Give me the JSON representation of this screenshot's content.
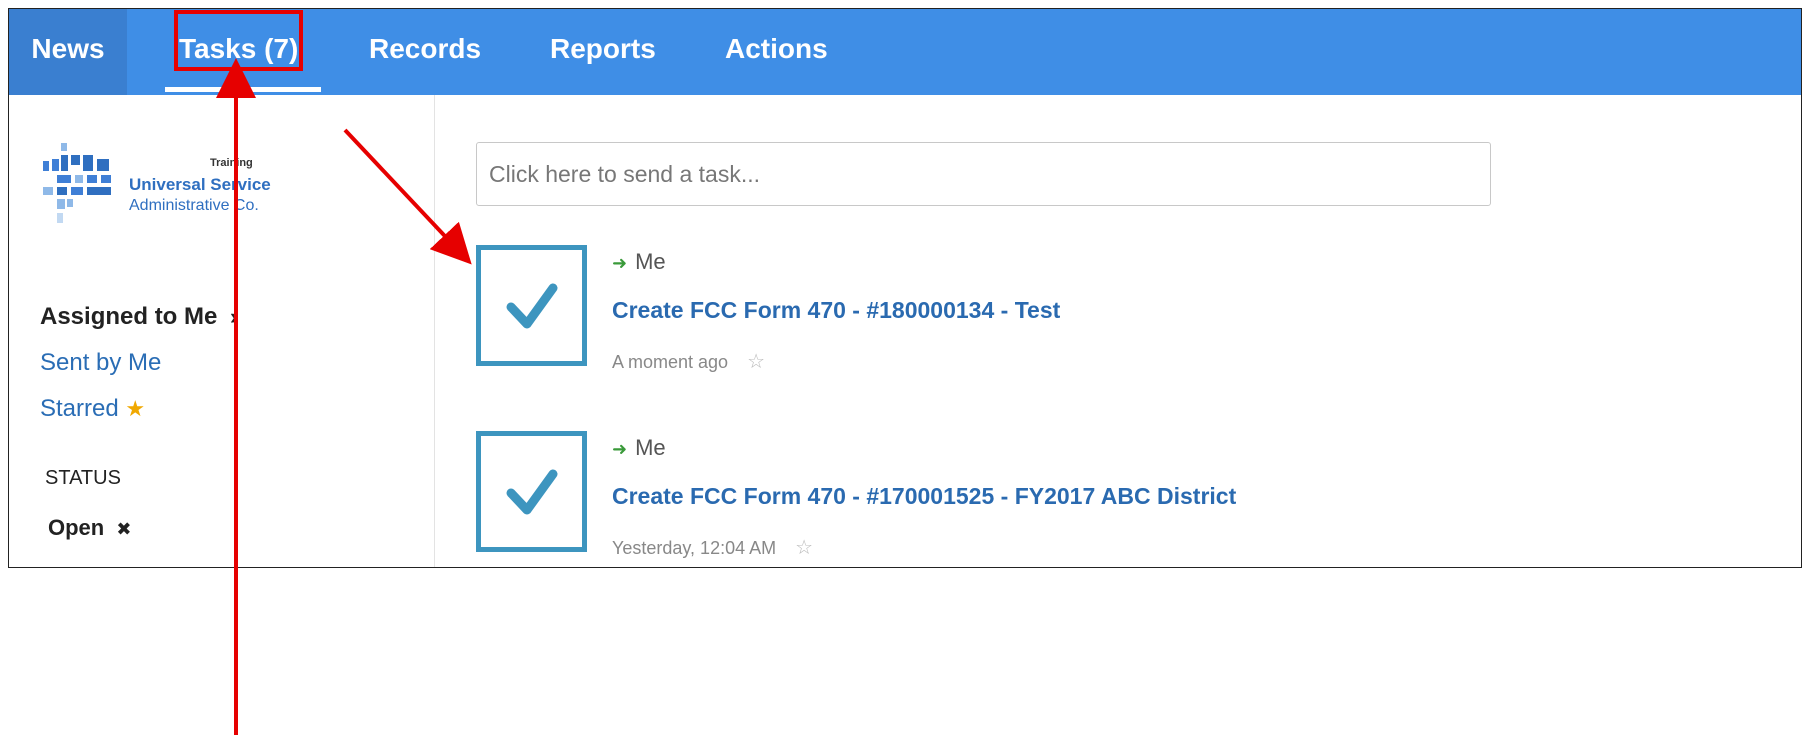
{
  "nav": {
    "news": "News",
    "tasks": "Tasks (7)",
    "records": "Records",
    "reports": "Reports",
    "actions": "Actions"
  },
  "logo": {
    "training": "Training",
    "line1": "Universal Service",
    "line2": "Administrative Co."
  },
  "sidebar": {
    "assigned": "Assigned to Me",
    "sent": "Sent by Me",
    "starred": "Starred",
    "status_heading": "STATUS",
    "status_open": "Open"
  },
  "main": {
    "send_placeholder": "Click here to send a task..."
  },
  "tasks": [
    {
      "assignee": "Me",
      "title": "Create FCC Form 470 - #180000134 - Test",
      "time": "A moment ago"
    },
    {
      "assignee": "Me",
      "title": "Create FCC Form 470 - #170001525 - FY2017 ABC District",
      "time": "Yesterday, 12:04 AM"
    }
  ],
  "colors": {
    "nav_bg": "#3f8ee6",
    "link": "#2a6ab0",
    "checkbox": "#3d95bf",
    "annotation": "#e60000"
  }
}
